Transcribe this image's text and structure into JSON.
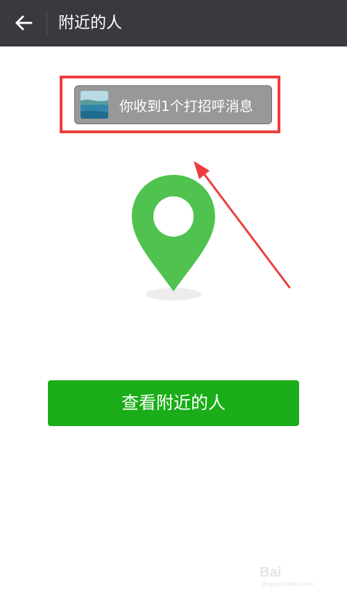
{
  "header": {
    "title": "附近的人",
    "back_icon": "arrow-left-icon"
  },
  "greeting": {
    "message": "你收到1个打招呼消息"
  },
  "main": {
    "pin_icon": "location-pin-icon",
    "view_button_label": "查看附近的人"
  },
  "watermark": {
    "logo": "Bai",
    "site": "jingyan.baidu.com"
  },
  "colors": {
    "header_bg": "#393a3f",
    "pin_green": "#4fc24f",
    "button_green": "#1aad19",
    "annotation_red": "#ef3b3b",
    "banner_gray": "#989898"
  }
}
